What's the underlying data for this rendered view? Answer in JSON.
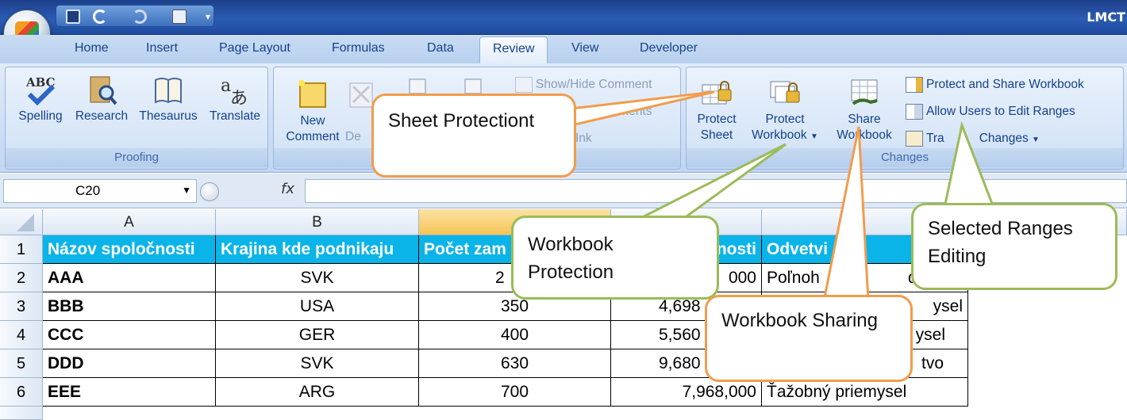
{
  "window": {
    "title": "LMCT"
  },
  "tabs": [
    "Home",
    "Insert",
    "Page Layout",
    "Formulas",
    "Data",
    "Review",
    "View",
    "Developer"
  ],
  "active_tab": "Review",
  "ribbon": {
    "proofing": {
      "label": "Proofing",
      "spelling": "Spelling",
      "research": "Research",
      "thesaurus": "Thesaurus",
      "translate": "Translate"
    },
    "comments": {
      "new_comment_1": "New",
      "new_comment_2": "Comment",
      "delete_partial": "De",
      "show_hide_comment": "Show/Hide Comment",
      "show_all_partial": "All Comments",
      "ink_partial": "Ink"
    },
    "changes": {
      "label": "Changes",
      "protect_sheet_1": "Protect",
      "protect_sheet_2": "Sheet",
      "protect_workbook_1": "Protect",
      "protect_workbook_2": "Workbook",
      "share_workbook_1": "Share",
      "share_workbook_2": "Workbook",
      "protect_share": "Protect and Share Workbook",
      "allow_users": "Allow Users to Edit Ranges",
      "track_changes_partial": "Tra",
      "track_changes_rest": "Changes"
    }
  },
  "formula_bar": {
    "name_box": "C20",
    "fx": "fx"
  },
  "columns": [
    "A",
    "B"
  ],
  "rows": [
    {
      "n": "1",
      "a": "Názov spoločnosti",
      "b": "Krajina kde podnikaju",
      "c": "Počet zam",
      "d": "nosti",
      "e": "Odvetvi"
    },
    {
      "n": "2",
      "a": "AAA",
      "b": "SVK",
      "c": "2",
      "d": "000",
      "e": "Poľnoh",
      "e2": "dárs"
    },
    {
      "n": "3",
      "a": "BBB",
      "b": "USA",
      "c": "350",
      "d": "4,698",
      "e2": "ysel"
    },
    {
      "n": "4",
      "a": "CCC",
      "b": "GER",
      "c": "400",
      "d": "5,560",
      "e2": "ysel"
    },
    {
      "n": "5",
      "a": "DDD",
      "b": "SVK",
      "c": "630",
      "d": "9,680",
      "e2": "tvo"
    },
    {
      "n": "6",
      "a": "EEE",
      "b": "ARG",
      "c": "700",
      "d": "7,968,000",
      "e": "Ťažobný priemysel"
    }
  ],
  "callouts": {
    "sheet_protection": "Sheet Protectiont",
    "workbook_protection_1": "Workbook",
    "workbook_protection_2": "Protection",
    "workbook_sharing": "Workbook Sharing",
    "selected_ranges_1": "Selected Ranges",
    "selected_ranges_2": "Editing"
  },
  "colors": {
    "header_fill": "#0ab4e8",
    "callout_orange": "#f29c4d",
    "callout_green": "#9bbb59"
  }
}
